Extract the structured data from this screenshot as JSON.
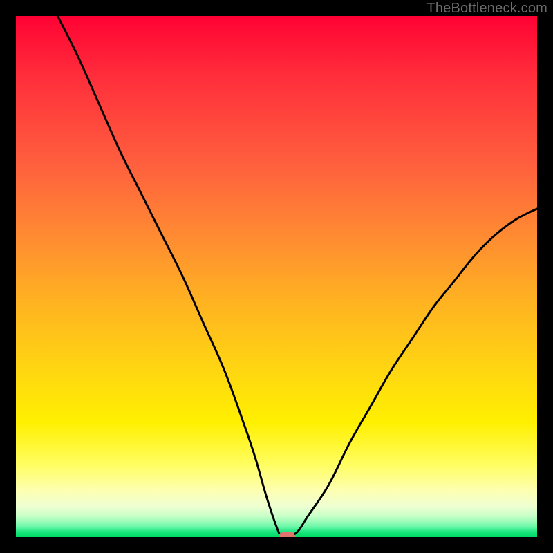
{
  "watermark": "TheBottleneck.com",
  "chart_data": {
    "type": "line",
    "title": "",
    "xlabel": "",
    "ylabel": "",
    "xlim": [
      0,
      100
    ],
    "ylim": [
      0,
      100
    ],
    "grid": false,
    "series": [
      {
        "name": "bottleneck-curve",
        "x": [
          8,
          12,
          16,
          20,
          24,
          28,
          32,
          36,
          40,
          44,
          46,
          48,
          50,
          51,
          52,
          54,
          56,
          60,
          64,
          68,
          72,
          76,
          80,
          84,
          88,
          92,
          96,
          100
        ],
        "y": [
          100,
          92,
          83,
          74,
          66,
          58,
          50,
          41,
          32,
          21,
          15,
          8,
          2,
          0,
          0,
          1,
          4,
          10,
          18,
          25,
          32,
          38,
          44,
          49,
          54,
          58,
          61,
          63
        ]
      }
    ],
    "marker": {
      "x": 52,
      "y": 0,
      "color": "#e1746c"
    },
    "gradient_colors": {
      "top": "#ff0033",
      "mid": "#fff000",
      "bottom": "#00d864"
    }
  }
}
